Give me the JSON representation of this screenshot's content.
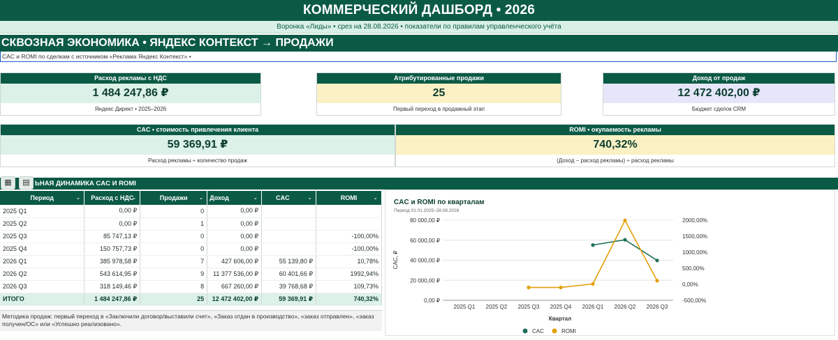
{
  "header": {
    "title": "КОММЕРЧЕСКИЙ ДАШБОРД • 2026",
    "subtitle": "Воронка «Лиды» • срез на 28.08.2026 • показатели по правилам управленческого учёта"
  },
  "section1": {
    "title": "СКВОЗНАЯ ЭКОНОМИКА • ЯНДЕКС КОНТЕКСТ → ПРОДАЖИ",
    "note": "CAC и ROMI по сделкам с источником «Реклама Яндекс Контекст» •"
  },
  "cards": {
    "ad_spend": {
      "label": "Расход рекламы с НДС",
      "value": "1 484 247,86 ₽",
      "foot": "Яндекс Директ • 2025–2026"
    },
    "sales": {
      "label": "Атрибутированные продажи",
      "value": "25",
      "foot": "Первый переход в продажный этап"
    },
    "revenue": {
      "label": "Доход от продаж",
      "value": "12 472 402,00 ₽",
      "foot": "Бюджет сделок CRM"
    },
    "cac": {
      "label": "CAC • стоимость привлечения клиента",
      "value": "59 369,91 ₽",
      "foot": "Расход рекламы ÷ количество продаж"
    },
    "romi": {
      "label": "ROMI • окупаемость рекламы",
      "value": "740,32%",
      "foot": "(Доход − расход рекламы) ÷ расход рекламы"
    }
  },
  "section2": {
    "title": "ЬНАЯ ДИНАМИКА CAC И ROMI"
  },
  "table": {
    "headers": [
      "Период",
      "Расход с НДС",
      "Продажи",
      "Доход",
      "CAC",
      "ROMI"
    ],
    "rows": [
      [
        "2025 Q1",
        "0,00 ₽",
        "0",
        "0,00 ₽",
        "",
        ""
      ],
      [
        "2025 Q2",
        "0,00 ₽",
        "1",
        "0,00 ₽",
        "",
        ""
      ],
      [
        "2025 Q3",
        "85 747,13 ₽",
        "0",
        "0,00 ₽",
        "",
        "-100,00%"
      ],
      [
        "2025 Q4",
        "150 757,73 ₽",
        "0",
        "0,00 ₽",
        "",
        "-100,00%"
      ],
      [
        "2026 Q1",
        "385 978,58 ₽",
        "7",
        "427 606,00 ₽",
        "55 139,80 ₽",
        "10,78%"
      ],
      [
        "2026 Q2",
        "543 614,95 ₽",
        "9",
        "11 377 536,00 ₽",
        "60 401,66 ₽",
        "1992,94%"
      ],
      [
        "2026 Q3",
        "318 149,46 ₽",
        "8",
        "667 260,00 ₽",
        "39 768,68 ₽",
        "109,73%"
      ]
    ],
    "total": [
      "ИТОГО",
      "1 484 247,86 ₽",
      "25",
      "12 472 402,00 ₽",
      "59 369,91 ₽",
      "740,32%"
    ]
  },
  "methodology": "Методика продаж: первый переход в «Заключили договор/выставили счет», «Заказ отдан в производство», «заказ отправлен», «заказ получен/ОС» или «Успешно реализовано».",
  "chart_data": {
    "type": "line",
    "title": "CAC и ROMI по кварталам",
    "subtitle": "Период 01.01.2025–28.08.2026",
    "xlabel": "Квартал",
    "ylabel": "CAC, ₽",
    "categories": [
      "2025 Q1",
      "2025 Q2",
      "2025 Q3",
      "2025 Q4",
      "2026 Q1",
      "2026 Q2",
      "2026 Q3"
    ],
    "y_ticks": [
      "0,00 ₽",
      "20 000,00 ₽",
      "40 000,00 ₽",
      "60 000,00 ₽",
      "80 000,00 ₽"
    ],
    "y2_ticks": [
      "-500,00%",
      "0,00%",
      "500,00%",
      "1000,00%",
      "1500,00%",
      "2000,00%"
    ],
    "ylim": [
      0,
      80000
    ],
    "y2lim": [
      -500,
      2000
    ],
    "series": [
      {
        "name": "CAC",
        "axis": "left",
        "color": "#1f6e5a",
        "values": [
          null,
          null,
          null,
          null,
          55139.8,
          60401.66,
          39768.68
        ]
      },
      {
        "name": "ROMI",
        "axis": "right",
        "color": "#e3a008",
        "values": [
          null,
          null,
          -100,
          -100,
          10.78,
          1992.94,
          109.73
        ]
      }
    ],
    "legend_position": "bottom",
    "grid": true
  }
}
